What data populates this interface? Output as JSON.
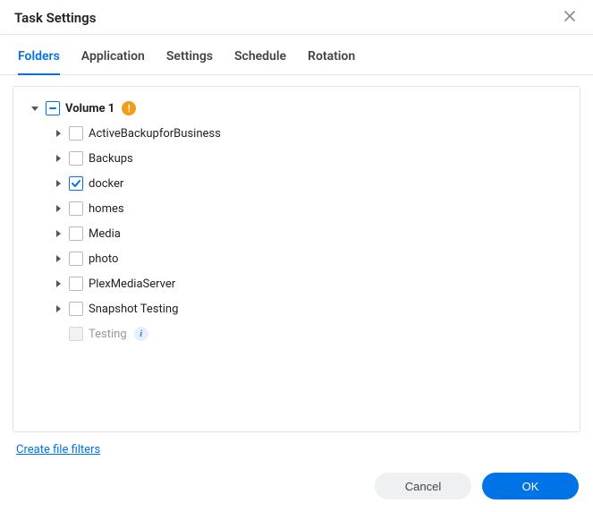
{
  "dialog": {
    "title": "Task Settings"
  },
  "tabs": [
    {
      "label": "Folders",
      "active": true
    },
    {
      "label": "Application",
      "active": false
    },
    {
      "label": "Settings",
      "active": false
    },
    {
      "label": "Schedule",
      "active": false
    },
    {
      "label": "Rotation",
      "active": false
    }
  ],
  "tree": {
    "root": {
      "label": "Volume 1",
      "expanded": true,
      "state": "indeterminate",
      "badge": "warn"
    },
    "children": [
      {
        "label": "ActiveBackupforBusiness",
        "state": "unchecked",
        "expandable": true
      },
      {
        "label": "Backups",
        "state": "unchecked",
        "expandable": true
      },
      {
        "label": "docker",
        "state": "checked",
        "expandable": true
      },
      {
        "label": "homes",
        "state": "unchecked",
        "expandable": true
      },
      {
        "label": "Media",
        "state": "unchecked",
        "expandable": true
      },
      {
        "label": "photo",
        "state": "unchecked",
        "expandable": true
      },
      {
        "label": "PlexMediaServer",
        "state": "unchecked",
        "expandable": true
      },
      {
        "label": "Snapshot Testing",
        "state": "unchecked",
        "expandable": true
      },
      {
        "label": "Testing",
        "state": "disabled",
        "expandable": false,
        "badge": "info"
      }
    ]
  },
  "link": {
    "create_filters": "Create file filters"
  },
  "buttons": {
    "cancel": "Cancel",
    "ok": "OK"
  },
  "badge_glyphs": {
    "warn": "!",
    "info": "i"
  }
}
